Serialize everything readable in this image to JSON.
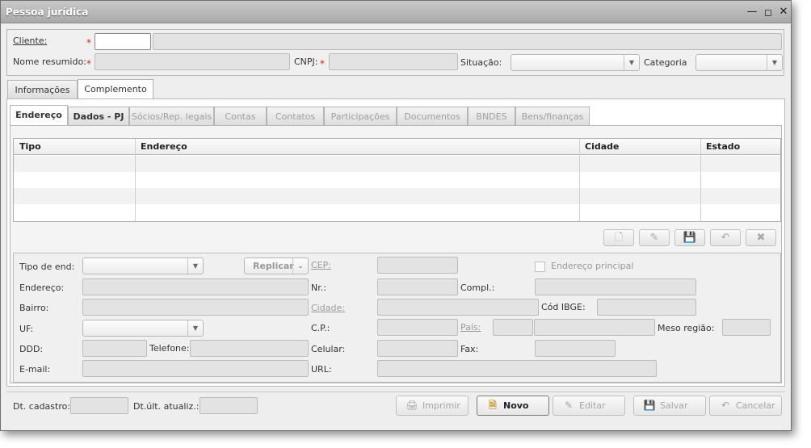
{
  "window": {
    "title": "Pessoa jurídica",
    "min_icon": "minimize-icon",
    "max_icon": "maximize-icon",
    "close_icon": "close-icon"
  },
  "header": {
    "cliente_label": "Cliente:",
    "nome_resumido_label": "Nome resumido:",
    "cnpj_label": "CNPJ:",
    "situacao_label": "Situação:",
    "categoria_label": "Categoria",
    "required_mark": "*"
  },
  "main_tabs": [
    {
      "label": "Informações"
    },
    {
      "label": "Complemento"
    }
  ],
  "sub_tabs": [
    {
      "label": "Endereço"
    },
    {
      "label": "Dados - PJ"
    },
    {
      "label": "Sócios/Rep. legais"
    },
    {
      "label": "Contas"
    },
    {
      "label": "Contatos"
    },
    {
      "label": "Participações"
    },
    {
      "label": "Documentos"
    },
    {
      "label": "BNDES"
    },
    {
      "label": "Bens/finanças"
    }
  ],
  "table": {
    "columns": [
      "Tipo",
      "Endereço",
      "Cidade",
      "Estado"
    ],
    "rows": []
  },
  "grid_toolbar": {
    "icons": [
      "new-doc-icon",
      "edit-icon",
      "save-icon",
      "undo-icon",
      "delete-icon"
    ]
  },
  "form": {
    "tipo_end_label": "Tipo de end:",
    "replicar_label": "Replicar",
    "cep_label": "CEP:",
    "endereco_principal_label": "Endereço principal",
    "endereco_label": "Endereço:",
    "nr_label": "Nr.:",
    "compl_label": "Compl.:",
    "bairro_label": "Bairro:",
    "cidade_label": "Cidade:",
    "cod_ibge_label": "Cód IBGE:",
    "uf_label": "UF:",
    "cp_label": "C.P.:",
    "pais_label": "País:",
    "meso_regiao_label": "Meso região:",
    "ddd_label": "DDD:",
    "telefone_label": "Telefone:",
    "celular_label": "Celular:",
    "fax_label": "Fax:",
    "email_label": "E-mail:",
    "url_label": "URL:"
  },
  "footer": {
    "dt_cadastro_label": "Dt. cadastro:",
    "dt_ult_atualiz_label": "Dt.últ. atualiz.:",
    "imprimir_label": "Imprimir",
    "novo_label": "Novo",
    "editar_label": "Editar",
    "salvar_label": "Salvar",
    "cancelar_label": "Cancelar"
  }
}
